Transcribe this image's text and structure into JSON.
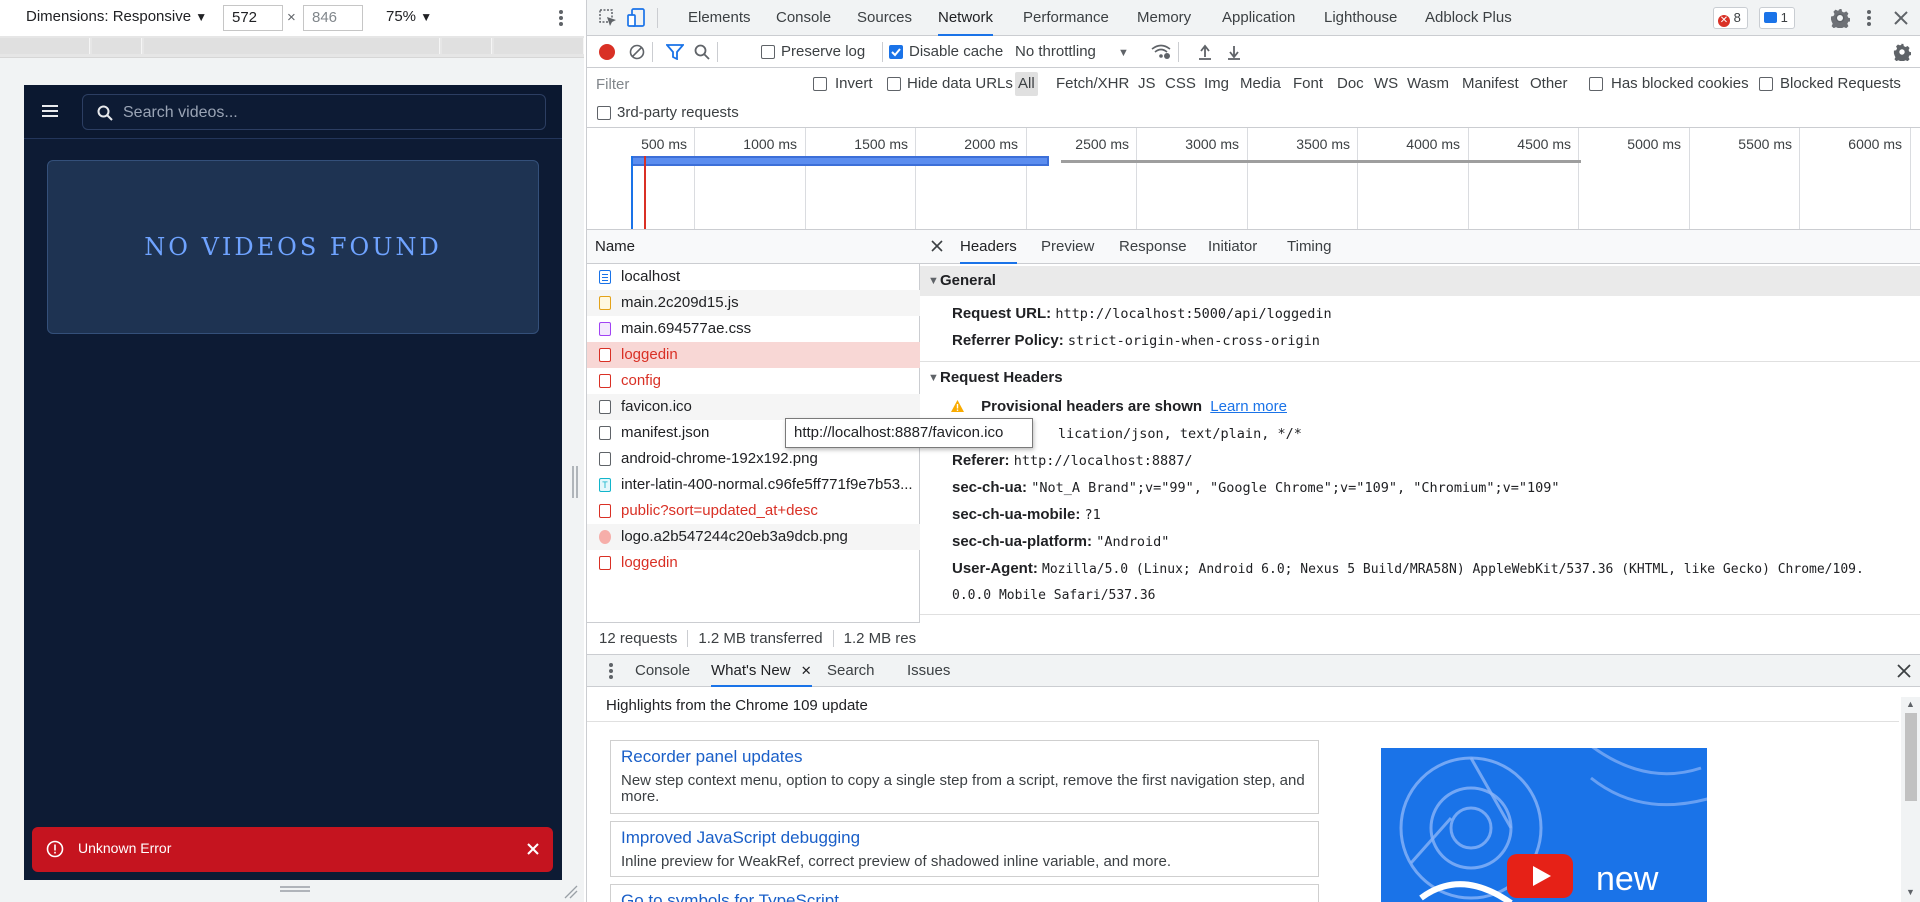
{
  "emulation": {
    "dimensions_label": "Dimensions: Responsive",
    "width_value": "572",
    "height_value": "846",
    "times": "×",
    "zoom_label": "75%"
  },
  "app": {
    "search_placeholder": "Search videos...",
    "empty_message": "NO VIDEOS FOUND",
    "toast_message": "Unknown Error"
  },
  "devtools": {
    "tabs": [
      "Elements",
      "Console",
      "Sources",
      "Network",
      "Performance",
      "Memory",
      "Application",
      "Lighthouse",
      "Adblock Plus"
    ],
    "active_tab": "Network",
    "error_count": "8",
    "message_count": "1",
    "toolbar": {
      "preserve_log": "Preserve log",
      "disable_cache": "Disable cache",
      "throttling": "No throttling"
    },
    "filter": {
      "placeholder": "Filter",
      "invert": "Invert",
      "hide_data_urls": "Hide data URLs",
      "types": [
        "All",
        "Fetch/XHR",
        "JS",
        "CSS",
        "Img",
        "Media",
        "Font",
        "Doc",
        "WS",
        "Wasm",
        "Manifest",
        "Other"
      ],
      "has_blocked_cookies": "Has blocked cookies",
      "blocked_requests": "Blocked Requests",
      "third_party": "3rd-party requests"
    },
    "overview_ticks": [
      "500 ms",
      "1000 ms",
      "1500 ms",
      "2000 ms",
      "2500 ms",
      "3000 ms",
      "3500 ms",
      "4000 ms",
      "4500 ms",
      "5000 ms",
      "5500 ms",
      "6000 ms"
    ],
    "requests": {
      "column_name": "Name",
      "rows": [
        {
          "name": "localhost",
          "icon": "document-icon",
          "error": false
        },
        {
          "name": "main.2c209d15.js",
          "icon": "script-icon",
          "error": false
        },
        {
          "name": "main.694577ae.css",
          "icon": "stylesheet-icon",
          "error": false
        },
        {
          "name": "loggedin",
          "icon": "failed-request-icon",
          "error": true
        },
        {
          "name": "config",
          "icon": "failed-request-icon",
          "error": true
        },
        {
          "name": "favicon.ico",
          "icon": "file-icon",
          "error": false
        },
        {
          "name": "manifest.json",
          "icon": "file-icon",
          "error": false
        },
        {
          "name": "android-chrome-192x192.png",
          "icon": "file-icon",
          "error": false
        },
        {
          "name": "inter-latin-400-normal.c96fe5ff771f9e7b53...",
          "icon": "font-icon",
          "error": false
        },
        {
          "name": "public?sort=updated_at+desc",
          "icon": "failed-request-icon",
          "error": true
        },
        {
          "name": "logo.a2b547244c20eb3a9dcb.png",
          "icon": "image-icon",
          "error": false
        },
        {
          "name": "loggedin",
          "icon": "failed-request-icon",
          "error": true
        }
      ],
      "status": {
        "requests": "12 requests",
        "transferred": "1.2 MB transferred",
        "resources": "1.2 MB res"
      },
      "tooltip": "http://localhost:8887/favicon.ico"
    },
    "detail_tabs": [
      "Headers",
      "Preview",
      "Response",
      "Initiator",
      "Timing"
    ],
    "general": {
      "title": "General",
      "request_url_key": "Request URL:",
      "request_url": "http://localhost:5000/api/loggedin",
      "referrer_policy_key": "Referrer Policy:",
      "referrer_policy": "strict-origin-when-cross-origin"
    },
    "request_headers": {
      "title": "Request Headers",
      "provisional": "Provisional headers are shown",
      "learn_more": "Learn more",
      "accept_tail": "lication/json, text/plain, */*",
      "referer_key": "Referer:",
      "referer": "http://localhost:8887/",
      "ua_key": "sec-ch-ua:",
      "ua": "\"Not_A Brand\";v=\"99\", \"Google Chrome\";v=\"109\", \"Chromium\";v=\"109\"",
      "mobile_key": "sec-ch-ua-mobile:",
      "mobile": "?1",
      "platform_key": "sec-ch-ua-platform:",
      "platform": "\"Android\"",
      "user_agent_key": "User-Agent:",
      "user_agent_line1": "Mozilla/5.0 (Linux; Android 6.0; Nexus 5 Build/MRA58N) AppleWebKit/537.36 (KHTML, like Gecko) Chrome/109.",
      "user_agent_line2": "0.0.0 Mobile Safari/537.36"
    },
    "drawer": {
      "tabs": [
        "Console",
        "What's New",
        "Search",
        "Issues"
      ],
      "active_tab": "What's New",
      "subtitle": "Highlights from the Chrome 109 update",
      "features": [
        {
          "title": "Recorder panel updates",
          "desc": "New step context menu, option to copy a single step from a script, remove the first navigation step, and more."
        },
        {
          "title": "Improved JavaScript debugging",
          "desc": "Inline preview for WeakRef, correct preview of shadowed inline variable, and more."
        },
        {
          "title": "Go to symbols for TypeScript",
          "desc": ""
        }
      ],
      "promo_word": "new"
    }
  }
}
